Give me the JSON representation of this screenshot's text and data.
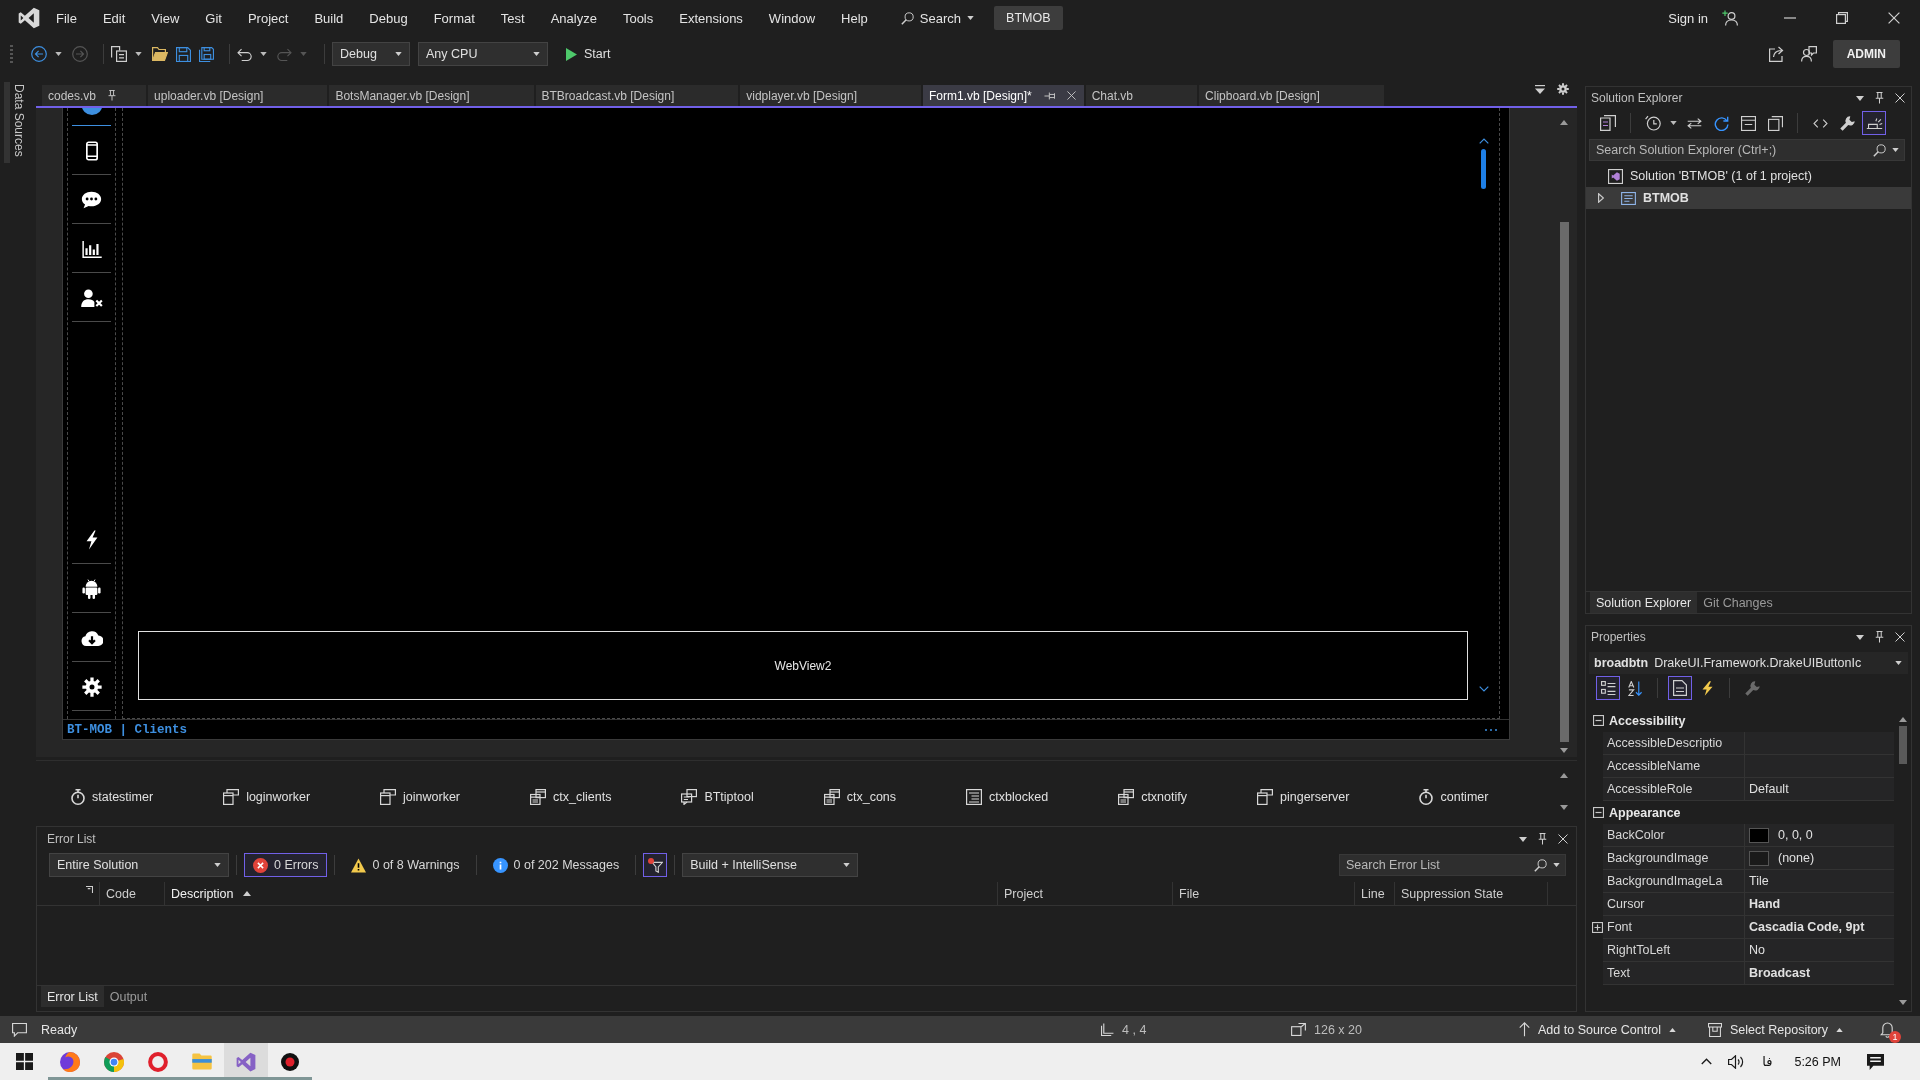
{
  "menu_bar": {
    "items": [
      "File",
      "Edit",
      "View",
      "Git",
      "Project",
      "Build",
      "Debug",
      "Format",
      "Test",
      "Analyze",
      "Tools",
      "Extensions",
      "Window",
      "Help"
    ],
    "search": "Search",
    "solution": "BTMOB",
    "sign_in": "Sign in"
  },
  "toolbar": {
    "configuration": "Debug",
    "platform": "Any CPU",
    "start": "Start",
    "account": "ADMIN"
  },
  "side_tabs": [
    "Data Sources"
  ],
  "document_tabs": [
    {
      "label": "codes.vb",
      "selected": false,
      "pinned": true
    },
    {
      "label": "uploader.vb [Design]",
      "selected": false,
      "pinned": false
    },
    {
      "label": "BotsManager.vb [Design]",
      "selected": false,
      "pinned": false
    },
    {
      "label": "BTBroadcast.vb [Design]",
      "selected": false,
      "pinned": false
    },
    {
      "label": "vidplayer.vb [Design]",
      "selected": false,
      "pinned": false
    },
    {
      "label": "Form1.vb [Design]*",
      "selected": true,
      "pinned": false
    },
    {
      "label": "Chat.vb",
      "selected": false,
      "pinned": false
    },
    {
      "label": "Clipboard.vb [Design]",
      "selected": false,
      "pinned": false
    }
  ],
  "designer": {
    "webview": "WebView2",
    "status_label": "BT-MOB | Clients"
  },
  "component_tray": [
    {
      "name": "statestimer",
      "kind": "timer"
    },
    {
      "name": "loginworker",
      "kind": "worker"
    },
    {
      "name": "joinworker",
      "kind": "worker"
    },
    {
      "name": "ctx_clients",
      "kind": "menu"
    },
    {
      "name": "BTtiptool",
      "kind": "tooltip"
    },
    {
      "name": "ctx_cons",
      "kind": "menu"
    },
    {
      "name": "ctxblocked",
      "kind": "list"
    },
    {
      "name": "ctxnotify",
      "kind": "menu"
    },
    {
      "name": "pingerserver",
      "kind": "worker"
    },
    {
      "name": "contimer",
      "kind": "timer"
    }
  ],
  "error_list": {
    "title": "Error List",
    "scope": "Entire Solution",
    "filters": [
      {
        "label": "0 Errors",
        "kind": "error",
        "selected": true
      },
      {
        "label": "0 of 8 Warnings",
        "kind": "warning",
        "selected": false
      },
      {
        "label": "0 of 202 Messages",
        "kind": "info",
        "selected": false
      }
    ],
    "filter_on": true,
    "source": "Build + IntelliSense",
    "search": {
      "placeholder": "Search Error List"
    },
    "columns": [
      {
        "label": "Code",
        "sorted": false
      },
      {
        "label": "Description",
        "sorted": true
      },
      {
        "label": "Project",
        "sorted": false
      },
      {
        "label": "File",
        "sorted": false
      },
      {
        "label": "Line",
        "sorted": false
      },
      {
        "label": "Suppression State",
        "sorted": false
      }
    ],
    "tabs": [
      {
        "label": "Error List",
        "selected": true
      },
      {
        "label": "Output",
        "selected": false
      }
    ]
  },
  "solution_explorer": {
    "title": "Solution Explorer",
    "toolbar": [
      {
        "kind": "views",
        "selected": false
      },
      {
        "kind": "history",
        "selected": false
      },
      {
        "kind": "sync",
        "selected": false
      },
      {
        "kind": "refresh",
        "selected": false
      },
      {
        "kind": "collapse",
        "selected": false
      },
      {
        "kind": "showall",
        "selected": false
      },
      {
        "kind": "code",
        "selected": false
      },
      {
        "kind": "properties",
        "selected": false
      },
      {
        "kind": "preview",
        "selected": true
      }
    ],
    "search": {
      "placeholder": "Search Solution Explorer (Ctrl+;)"
    },
    "tree": [
      {
        "label": "Solution 'BTMOB' (1 of 1 project)",
        "kind": "solution",
        "selected": false,
        "startup": false,
        "children": [
          {
            "label": "BTMOB",
            "kind": "project",
            "selected": true,
            "startup": true,
            "expanded": false
          }
        ]
      }
    ],
    "tabs": [
      {
        "label": "Solution Explorer",
        "selected": true
      },
      {
        "label": "Git Changes",
        "selected": false
      }
    ]
  },
  "properties": {
    "title": "Properties",
    "object_name": "broadbtn",
    "object_type": "DrakeUI.Framework.DrakeUIButtonIc",
    "toolbar": [
      {
        "kind": "categorized",
        "selected": true
      },
      {
        "kind": "alphabetical",
        "selected": false
      },
      {
        "kind": "properties",
        "selected": true
      },
      {
        "kind": "events",
        "selected": false
      },
      {
        "kind": "pages",
        "selected": false
      }
    ],
    "categories": [
      {
        "label": "Accessibility",
        "expanded": true,
        "rows": [
          {
            "name": "AccessibleDescriptio",
            "kind": "text"
          },
          {
            "name": "AccessibleName",
            "kind": "text"
          },
          {
            "name": "AccessibleRole",
            "kind": "text",
            "value": "Default",
            "modified": false
          }
        ]
      },
      {
        "label": "Appearance",
        "expanded": true,
        "rows": [
          {
            "name": "BackColor",
            "kind": "color",
            "color": "#000000",
            "value": "0, 0, 0",
            "modified": false
          },
          {
            "name": "BackgroundImage",
            "kind": "image",
            "value": "(none)",
            "modified": false
          },
          {
            "name": "BackgroundImageLa",
            "kind": "text",
            "value": "Tile",
            "modified": false
          },
          {
            "name": "Cursor",
            "kind": "text",
            "value": "Hand",
            "modified": true
          },
          {
            "name": "Font",
            "kind": "group",
            "expanded": false,
            "value": "Cascadia Code, 9pt",
            "modified": true
          },
          {
            "name": "RightToLeft",
            "kind": "text",
            "value": "No",
            "modified": false
          },
          {
            "name": "Text",
            "kind": "text",
            "value": "Broadcast",
            "modified": true
          }
        ]
      }
    ]
  },
  "status_bar": {
    "state": "Ready",
    "position": "4 , 4",
    "size": "126 x 20",
    "source_control": "Add to Source Control",
    "repository": "Select Repository",
    "notifications": "1"
  },
  "taskbar": {
    "apps": [
      {
        "kind": "fox",
        "selected": false
      },
      {
        "kind": "ball",
        "selected": false
      },
      {
        "kind": "ring",
        "selected": false
      },
      {
        "kind": "folder",
        "selected": false
      },
      {
        "kind": "studio",
        "selected": true
      },
      {
        "kind": "record",
        "selected": false
      }
    ],
    "language": "فا",
    "time": "5:26 PM"
  }
}
